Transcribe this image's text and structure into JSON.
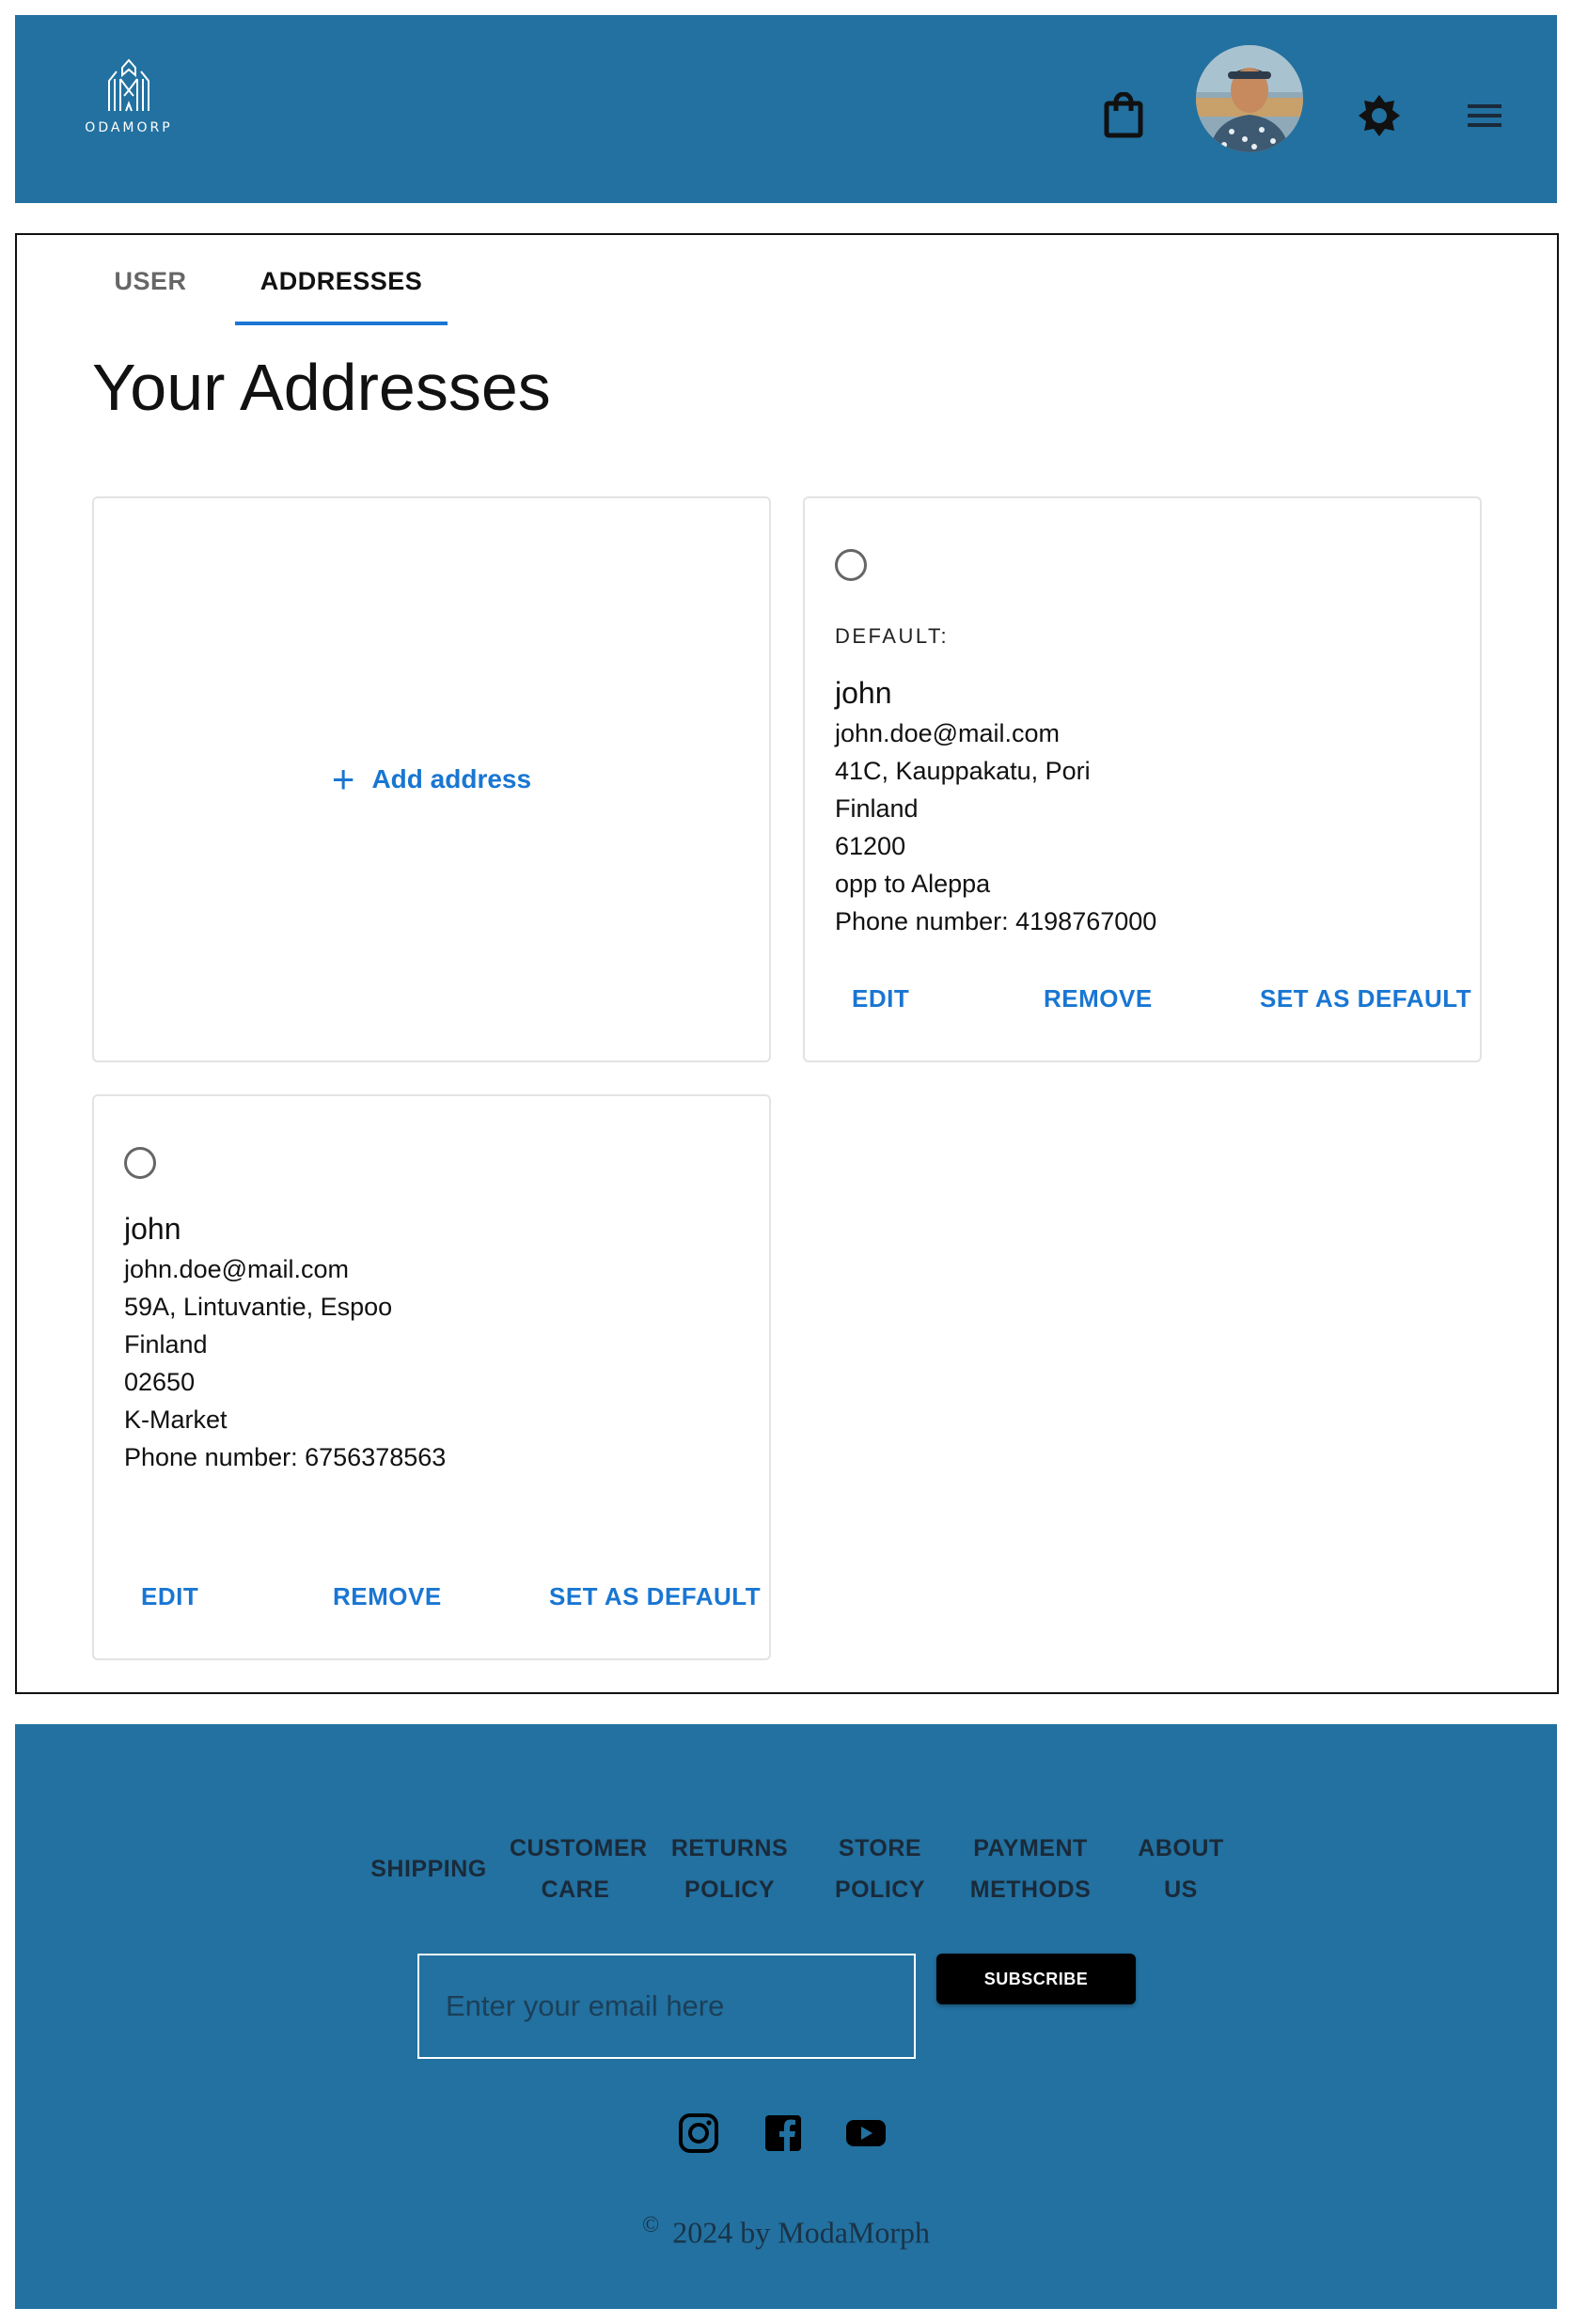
{
  "header": {
    "logo_text": "ODAMORP",
    "icons": [
      "shopping-bag-icon",
      "avatar",
      "brightness-icon",
      "menu-icon"
    ],
    "brand_color": "#2271a0"
  },
  "tabs": [
    {
      "label": "USER",
      "active": false
    },
    {
      "label": "ADDRESSES",
      "active": true
    }
  ],
  "page_title": "Your Addresses",
  "add_card": {
    "label": "Add address",
    "icon": "plus-icon"
  },
  "addresses": [
    {
      "default_label": "DEFAULT:",
      "name": "john",
      "email": "john.doe@mail.com",
      "street": "41C, Kauppakatu, Pori",
      "country": "Finland",
      "postal": "61200",
      "note": "opp to Aleppa",
      "phone": "Phone number: 4198767000",
      "actions": {
        "edit": "EDIT",
        "remove": "REMOVE",
        "set_default": "SET AS DEFAULT"
      }
    },
    {
      "name": "john",
      "email": "john.doe@mail.com",
      "street": "59A, Lintuvantie, Espoo",
      "country": "Finland",
      "postal": "02650",
      "note": "K-Market",
      "phone": "Phone number: 6756378563",
      "actions": {
        "edit": "EDIT",
        "remove": "REMOVE",
        "set_default": "SET AS DEFAULT"
      }
    }
  ],
  "footer": {
    "nav": [
      {
        "line1": "SHIPPING",
        "line2": ""
      },
      {
        "line1": "CUSTOMER",
        "line2": "CARE"
      },
      {
        "line1": "RETURNS",
        "line2": "POLICY"
      },
      {
        "line1": "STORE",
        "line2": "POLICY"
      },
      {
        "line1": "PAYMENT",
        "line2": "METHODS"
      },
      {
        "line1": "ABOUT",
        "line2": "US"
      }
    ],
    "email_placeholder": "Enter your email here",
    "subscribe_label": "SUBSCRIBE",
    "social": [
      "instagram-icon",
      "facebook-icon",
      "youtube-icon"
    ],
    "copyright_symbol": "©",
    "copyright": "2024 by ModaMorph"
  },
  "accent_color": "#1976d2"
}
